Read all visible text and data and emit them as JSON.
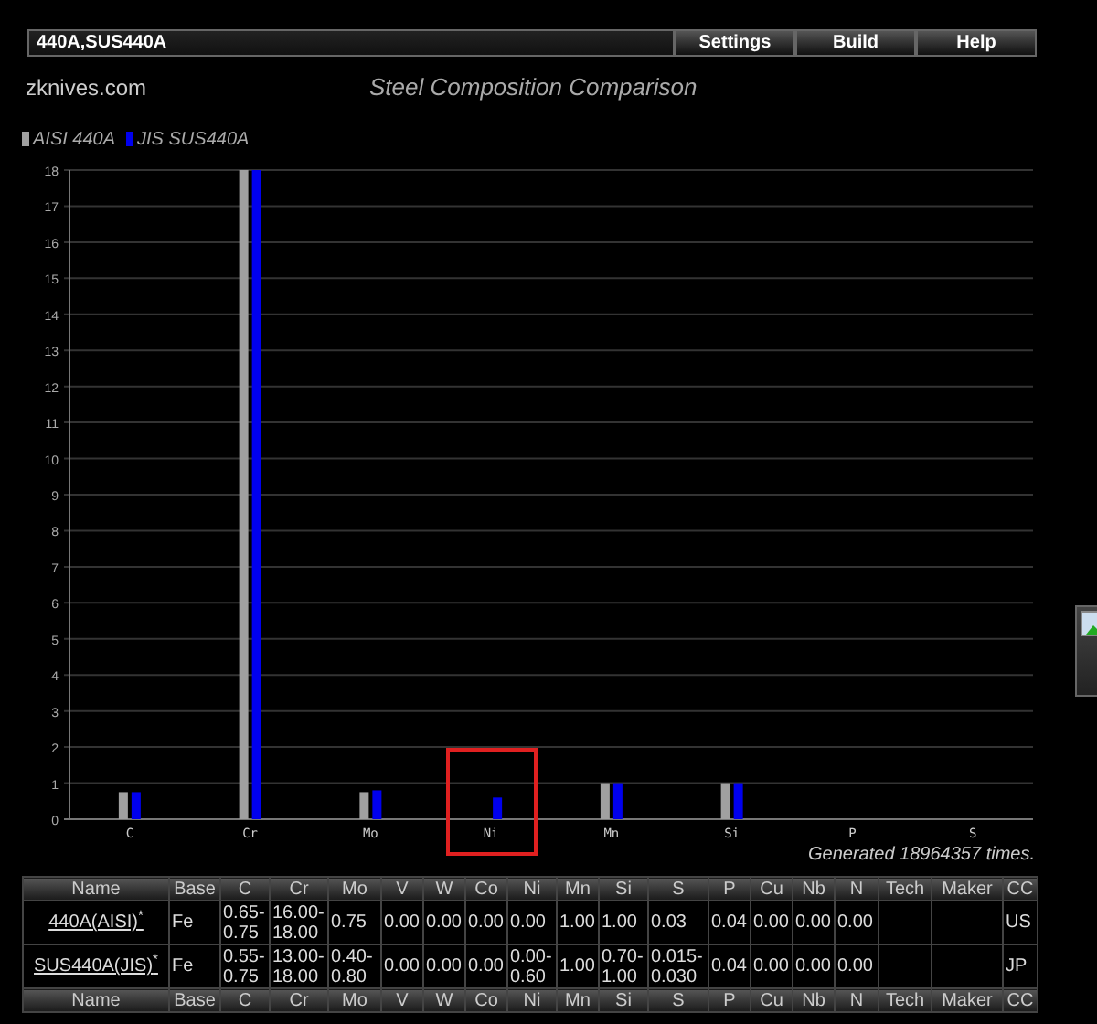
{
  "toolbar": {
    "title": "440A,SUS440A",
    "buttons": [
      "Settings",
      "Build",
      "Help"
    ]
  },
  "site": "zknives.com",
  "chart": {
    "chart_data": {
      "type": "bar",
      "title": "Steel Composition Comparison",
      "categories": [
        "C",
        "Cr",
        "Mo",
        "Ni",
        "Mn",
        "Si",
        "P",
        "S"
      ],
      "series": [
        {
          "name": "AISI 440A",
          "color": "#a0a0a0",
          "values": [
            0.75,
            18,
            0.75,
            0,
            1,
            1,
            null,
            null
          ]
        },
        {
          "name": "JIS SUS440A",
          "color": "#0000ee",
          "values": [
            0.75,
            18,
            0.8,
            0.6,
            1,
            1,
            null,
            null
          ]
        }
      ],
      "ylim": [
        0,
        18
      ],
      "yticks": [
        0,
        1,
        2,
        3,
        4,
        5,
        6,
        7,
        8,
        9,
        10,
        11,
        12,
        13,
        14,
        15,
        16,
        17,
        18
      ],
      "grid": true
    },
    "highlight": {
      "kind": "box",
      "boxed": [
        false,
        false,
        false,
        true,
        false,
        false,
        false,
        false
      ],
      "color": "#e02020"
    },
    "footer": "Generated 18964357 times."
  },
  "table": {
    "columns": [
      "Name",
      "Base",
      "C",
      "Cr",
      "Mo",
      "V",
      "W",
      "Co",
      "Ni",
      "Mn",
      "Si",
      "S",
      "P",
      "Cu",
      "Nb",
      "N",
      "Tech",
      "Maker",
      "CC"
    ],
    "rows": [
      {
        "cells": [
          "440A(AISI)$^{*}$",
          "Fe",
          "0.65-0.75",
          "16.00-18.00",
          "0.75",
          "0.00",
          "0.00",
          "0.00",
          "0.00",
          "1.00",
          "1.00",
          "0.03",
          "0.04",
          "0.00",
          "0.00",
          "0.00",
          "",
          "",
          "US"
        ]
      },
      {
        "cells": [
          "SUS440A(JIS)$^{*}$",
          "Fe",
          "0.55-0.75",
          "13.00-18.00",
          "0.40-0.80",
          "0.00",
          "0.00",
          "0.00",
          "0.00-0.60",
          "1.00",
          "0.70-1.00",
          "0.015-0.030",
          "0.04",
          "0.00",
          "0.00",
          "0.00",
          "",
          "",
          "JP"
        ]
      }
    ],
    "footer_columns": [
      "Name",
      "Base",
      "C",
      "Cr",
      "Mo",
      "V",
      "W",
      "Co",
      "Ni",
      "Mn",
      "Si",
      "S",
      "P",
      "Cu",
      "Nb",
      "N",
      "Tech",
      "Maker",
      "CC"
    ]
  }
}
